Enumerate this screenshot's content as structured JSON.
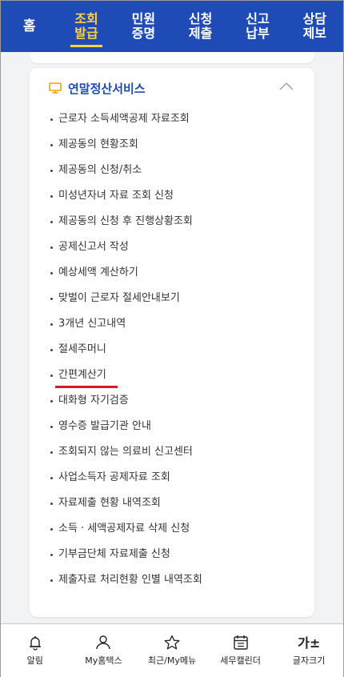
{
  "nav": {
    "items": [
      {
        "line1": "홈",
        "line2": ""
      },
      {
        "line1": "조회",
        "line2": "발급"
      },
      {
        "line1": "민원",
        "line2": "증명"
      },
      {
        "line1": "신청",
        "line2": "제출"
      },
      {
        "line1": "신고",
        "line2": "납부"
      },
      {
        "line1": "상담",
        "line2": "제보"
      }
    ],
    "active_index": 1
  },
  "section": {
    "title": "연말정산서비스",
    "icon": "monitor-icon",
    "collapse_icon": "chevron-up-icon",
    "items": [
      "근로자 소득세액공제 자료조회",
      "제공동의 현황조회",
      "제공동의 신청/취소",
      "미성년자녀 자료 조회 신청",
      "제공동의 신청 후 진행상황조회",
      "공제신고서 작성",
      "예상세액 계산하기",
      "맞벌이 근로자 절세안내보기",
      "3개년 신고내역",
      "절세주머니",
      "간편계산기",
      "대화형 자기검증",
      "영수증 발급기관 안내",
      "조회되지 않는 의료비 신고센터",
      "사업소득자 공제자료 조회",
      "자료제출 현황 내역조회",
      "소득 · 세액공제자료 삭제 신청",
      "기부금단체 자료제출 신청",
      "제출자료 처리현황 인별 내역조회"
    ],
    "highlighted_index": 10
  },
  "bottom": {
    "items": [
      {
        "label": "알림",
        "icon": "bell-icon"
      },
      {
        "label": "My홈택스",
        "icon": "person-icon"
      },
      {
        "label": "최근/My메뉴",
        "icon": "star-icon"
      },
      {
        "label": "세무캘린더",
        "icon": "calendar-icon"
      },
      {
        "label": "글자크기",
        "icon": "text-size-icon",
        "glyph": "가±"
      }
    ]
  },
  "colors": {
    "nav_bg": "#1e4bb5",
    "nav_active": "#ffd23d",
    "title": "#1e4bb5",
    "highlight_underline": "#d71920",
    "monitor_icon": "#f0a400"
  }
}
